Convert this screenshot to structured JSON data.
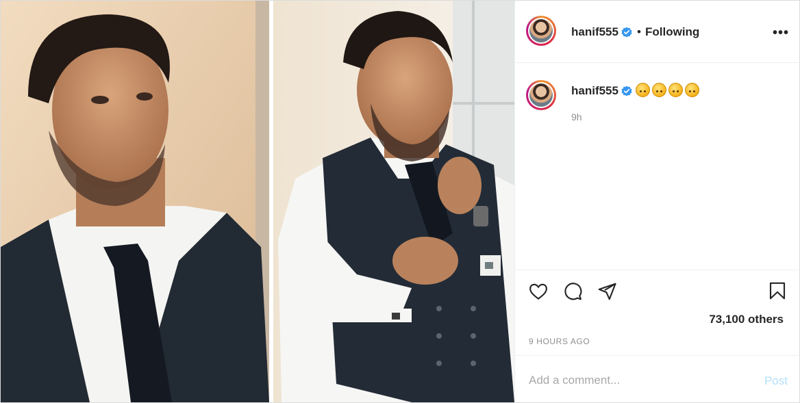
{
  "post": {
    "username": "hanif555",
    "separator": "•",
    "follow_status": "Following",
    "more_label": "•••",
    "caption_time": "9h",
    "likes_text": "73,100 others",
    "posted_ago": "9 HOURS AGO",
    "comment_placeholder": "Add a comment...",
    "post_label": "Post"
  },
  "icons": {
    "verified": "verified-badge-icon",
    "like": "heart-icon",
    "comment": "comment-bubble-icon",
    "share": "paper-plane-icon",
    "save": "bookmark-icon",
    "emoji": "upside-down-face-emoji"
  },
  "colors": {
    "verified_blue": "#3897f0",
    "post_button_disabled": "#b2dffc",
    "muted_text": "#8e8e8e"
  }
}
